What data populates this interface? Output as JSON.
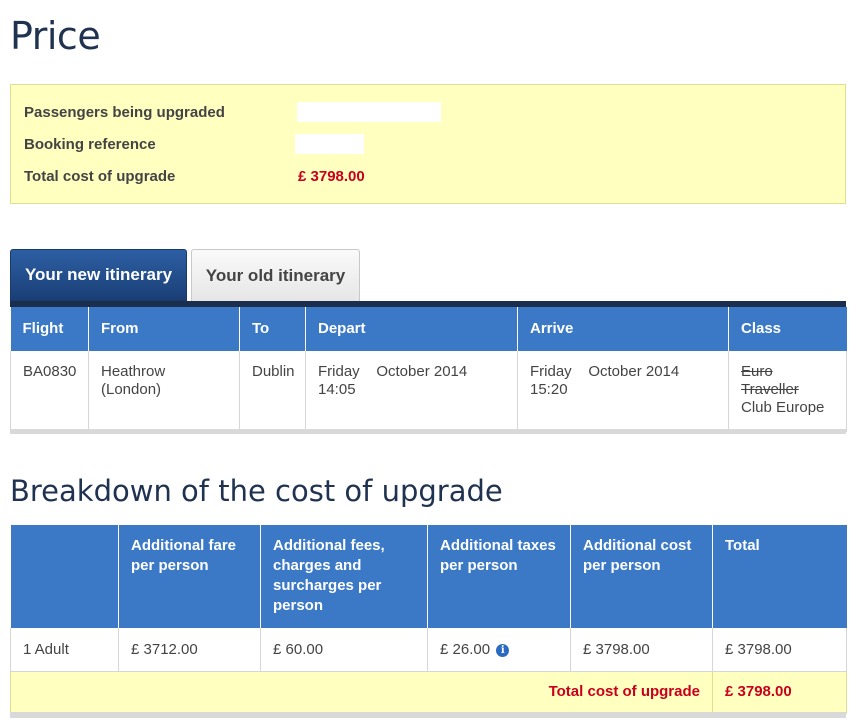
{
  "page": {
    "title": "Price"
  },
  "summary": {
    "passengers_label": "Passengers being upgraded",
    "passengers_value": "",
    "booking_ref_label": "Booking reference",
    "booking_ref_value": "",
    "total_label": "Total cost of upgrade",
    "total_value": "£ 3798.00"
  },
  "tabs": {
    "new_label": "Your new itinerary",
    "old_label": "Your old itinerary",
    "active": "new"
  },
  "itinerary": {
    "headers": [
      "Flight",
      "From",
      "To",
      "Depart",
      "Arrive",
      "Class"
    ],
    "row": {
      "flight": "BA0830",
      "from": "Heathrow (London)",
      "to": "Dublin",
      "depart": "Friday    October 2014 14:05",
      "arrive": "Friday    October 2014 15:20",
      "class_old": "Euro Traveller",
      "class_new": "Club Europe"
    }
  },
  "breakdown": {
    "title": "Breakdown of the cost of upgrade",
    "headers": [
      "",
      "Additional fare per person",
      "Additional fees, charges and surcharges per person",
      "Additional taxes per person",
      "Additional cost per person",
      "Total"
    ],
    "row": {
      "passenger": "1 Adult",
      "fare": "£ 3712.00",
      "fees": "£ 60.00",
      "taxes": "£ 26.00",
      "cost": "£ 3798.00",
      "total": "£ 3798.00"
    },
    "total_label": "Total cost of upgrade",
    "total_value": "£ 3798.00"
  },
  "icons": {
    "taxes_info": "info-icon"
  },
  "colors": {
    "header_blue": "#3b79c7",
    "title_navy": "#1f3250",
    "summary_yellow": "#ffffc0",
    "price_red": "#c8001e"
  }
}
